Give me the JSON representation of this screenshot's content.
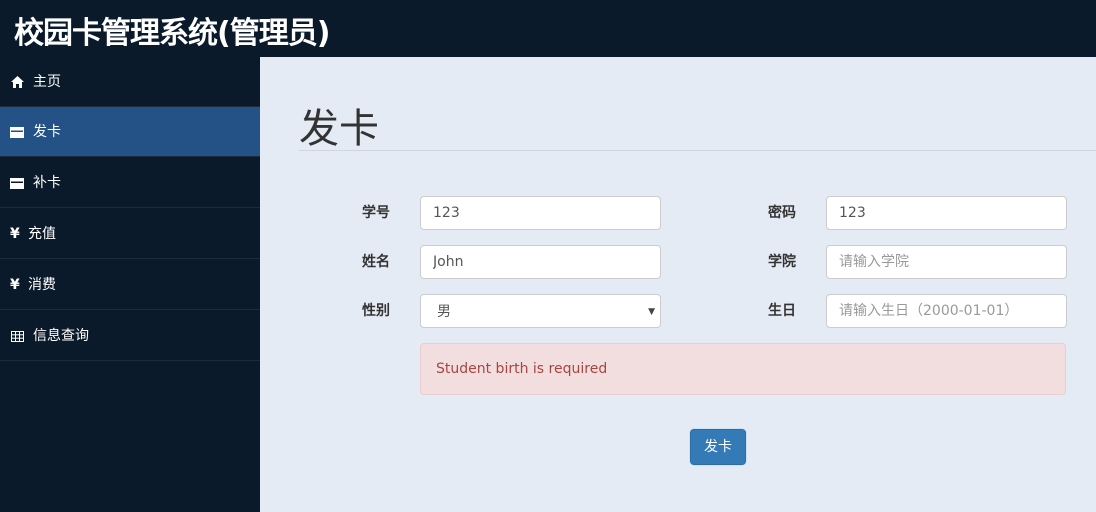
{
  "app": {
    "title": "校园卡管理系统(管理员)"
  },
  "sidebar": {
    "items": [
      {
        "label": "主页",
        "icon": "home-icon",
        "active": false
      },
      {
        "label": "发卡",
        "icon": "card-icon",
        "active": true
      },
      {
        "label": "补卡",
        "icon": "card-icon",
        "active": false
      },
      {
        "label": "充值",
        "icon": "yen-icon",
        "symbol": "¥",
        "active": false
      },
      {
        "label": "消费",
        "icon": "yen-icon",
        "symbol": "¥",
        "active": false
      },
      {
        "label": "信息查询",
        "icon": "table-icon",
        "active": false
      }
    ]
  },
  "page": {
    "title": "发卡"
  },
  "form": {
    "student_id": {
      "label": "学号",
      "value": "123"
    },
    "password": {
      "label": "密码",
      "value": "123"
    },
    "name": {
      "label": "姓名",
      "value": "John"
    },
    "college": {
      "label": "学院",
      "value": "",
      "placeholder": "请输入学院"
    },
    "gender": {
      "label": "性别",
      "value": "男"
    },
    "birthday": {
      "label": "生日",
      "value": "",
      "placeholder": "请输入生日（2000-01-01）"
    }
  },
  "alert": {
    "message": "Student birth is required"
  },
  "submit": {
    "label": "发卡"
  },
  "colors": {
    "topbar_bg": "#0b1a2b",
    "sidebar_active": "#245286",
    "content_bg": "#e5ebf4",
    "primary_button": "#337ab7",
    "alert_bg": "#f2dede",
    "alert_text": "#a94442"
  }
}
